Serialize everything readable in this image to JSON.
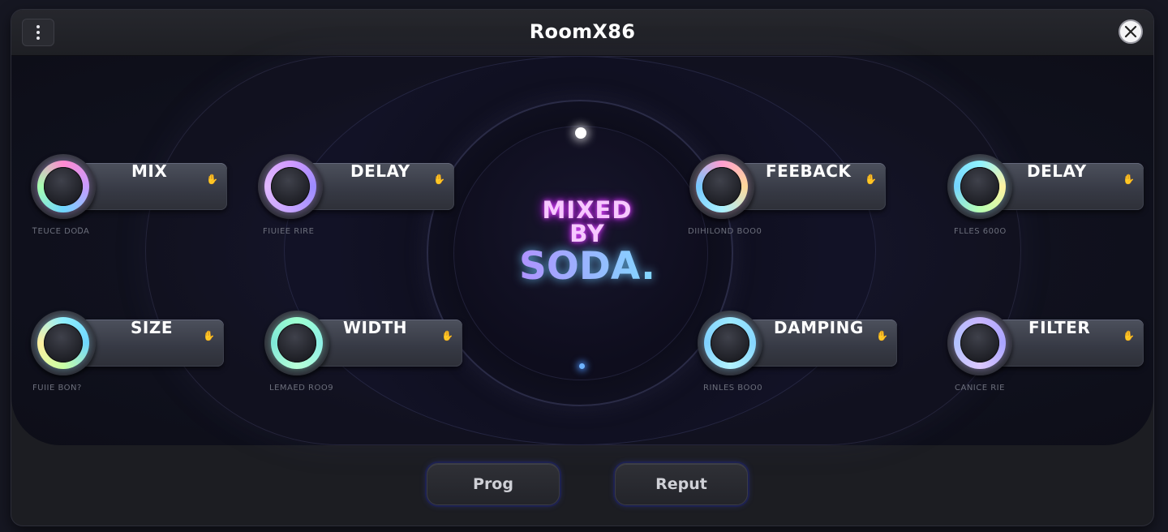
{
  "window": {
    "title": "RoomX86"
  },
  "titlebar": {
    "menu_icon": "vertical-dots-icon",
    "close_icon": "close-icon"
  },
  "logo": {
    "line1": "MIXED",
    "line2": "BY",
    "line3": "SODA."
  },
  "knobs": [
    {
      "label": "MIX",
      "sub": "ᎢEUCE DOᎠA",
      "ring": "pink-blue"
    },
    {
      "label": "DELAY",
      "sub": "FIUIEE RIRE",
      "ring": "violet"
    },
    {
      "label": "FEEBACK",
      "sub": "DIIHILOND BOO0",
      "ring": "pink-cyan"
    },
    {
      "label": "DELAY",
      "sub": "FLLES 600O",
      "ring": "cyan-yellow"
    },
    {
      "label": "SIZE",
      "sub": "FUIIE BON?",
      "ring": "cyan-yellow"
    },
    {
      "label": "WIDTH",
      "sub": "LEMAED ROO9",
      "ring": "mint"
    },
    {
      "label": "DAMPING",
      "sub": "RINLES BOO0",
      "ring": "sky"
    },
    {
      "label": "FILTER",
      "sub": "CANICE RIE",
      "ring": "lavender"
    }
  ],
  "footer": {
    "left_button": "Prog",
    "right_button": "Reput"
  },
  "colors": {
    "accent_glow": "#3a46d8",
    "logo_pink": "#e14bff",
    "logo_cyan": "#7ddfff"
  }
}
